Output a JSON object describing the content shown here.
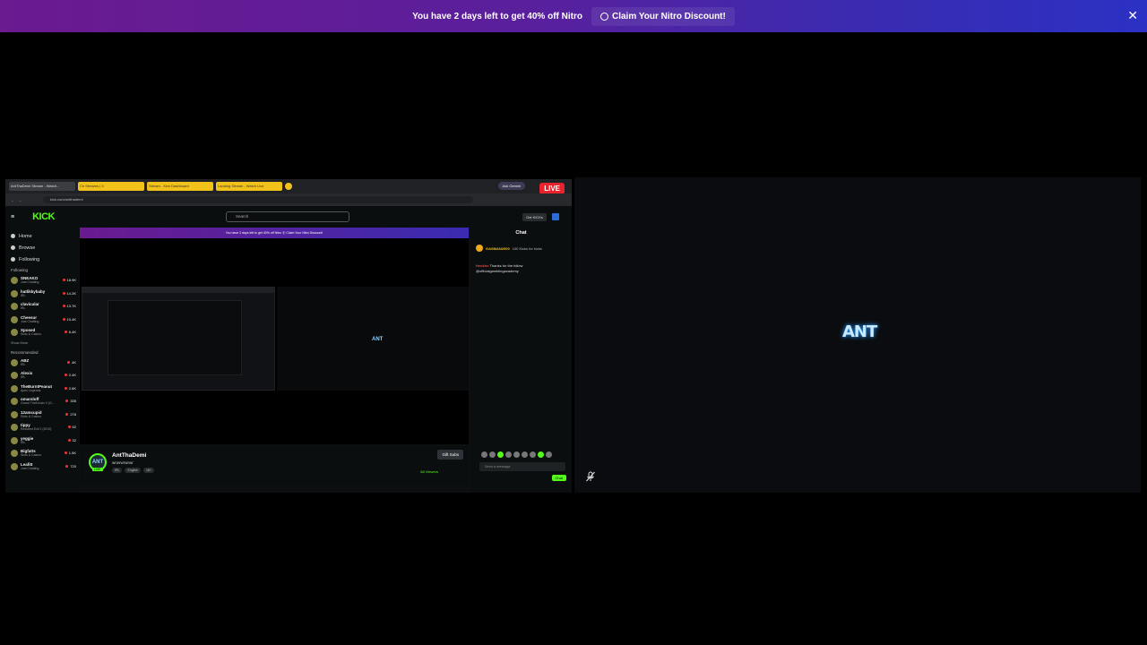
{
  "nitro": {
    "message": "You have 2 days left to get 40% off Nitro",
    "claim_label": "Claim Your Nitro Discount!",
    "close_glyph": "✕"
  },
  "left_stream": {
    "live_badge": "LIVE",
    "browser": {
      "tabs": [
        "AntThaDemi Stream - Watch...",
        "Ch Streams | 3",
        "Stream - Kick Dashboard",
        "Landing Stream - Watch Live"
      ],
      "ask_gemini": "Ask Gemini",
      "url": "kick.com/antthademi"
    },
    "kick": {
      "logo": "KICK",
      "search_placeholder": "Search",
      "get_kicks": "Get KICKs",
      "nav": [
        "Home",
        "Browse",
        "Following"
      ],
      "following_header": "Following",
      "following": [
        {
          "name": "SNEAKO",
          "game": "Just Chatting",
          "viewers": "18.9K"
        },
        {
          "name": "hatlikkybaby",
          "game": "IRL",
          "viewers": "14.2K"
        },
        {
          "name": "clavicular",
          "game": "IRL",
          "viewers": "13.7K"
        },
        {
          "name": "Cheesur",
          "game": "Just Chatting",
          "viewers": "10.4K"
        },
        {
          "name": "Xposed",
          "game": "Slots & Casino",
          "viewers": "6.4K"
        }
      ],
      "show_more": "Show More",
      "recommended_header": "Recommended",
      "recommended": [
        {
          "name": "ABZ",
          "game": "IRL",
          "viewers": "4K"
        },
        {
          "name": "Alexis",
          "game": "IRL",
          "viewers": "2.4K"
        },
        {
          "name": "TheBurntPeanut",
          "game": "Apex Legends",
          "viewers": "2.6K"
        },
        {
          "name": "omarsloff",
          "game": "Grand Theft Auto V (G...",
          "viewers": "335"
        },
        {
          "name": "12amcupid",
          "game": "Slots & Casino",
          "viewers": "278"
        },
        {
          "name": "tippy",
          "game": "Resident Evil 2 (2019)",
          "viewers": "62"
        },
        {
          "name": "yeggie",
          "game": "IRL",
          "viewers": "32"
        },
        {
          "name": "Bigfatts",
          "game": "Slots & Casino",
          "viewers": "1.5K"
        },
        {
          "name": "Leafitt",
          "game": "Just Chatting",
          "viewers": "720"
        }
      ],
      "inner_nitro": "You have 2 days left to get 40% off Nitro   ⦿ Claim Your Nitro Discount!",
      "mini_ant": "ANT",
      "streamer": {
        "avatar": "ANT",
        "live": "LIVE",
        "name": "AntThaDemi",
        "title": "wrwrwrwrwr",
        "tags": [
          "IRL",
          "English",
          "18+"
        ],
        "gift_subs": "Gift Subs",
        "viewers": "68 Viewers"
      },
      "chat": {
        "title": "Chat",
        "pinned_user": "GASMAN2000",
        "pinned_text": "100 Kicks for kicks",
        "msg_user": "Heckler",
        "msg_text": "Thanks for the follow @officialgamblingacademy",
        "input_placeholder": "Send a message",
        "send_label": "Chat"
      }
    }
  },
  "right_stream": {
    "logo_text": "ANT",
    "muted_icon": "mic-muted-icon"
  },
  "colors": {
    "kick_green": "#53fc18",
    "live_red": "#e8232e",
    "nitro_start": "#6b1a8f",
    "nitro_end": "#2b31c4"
  }
}
